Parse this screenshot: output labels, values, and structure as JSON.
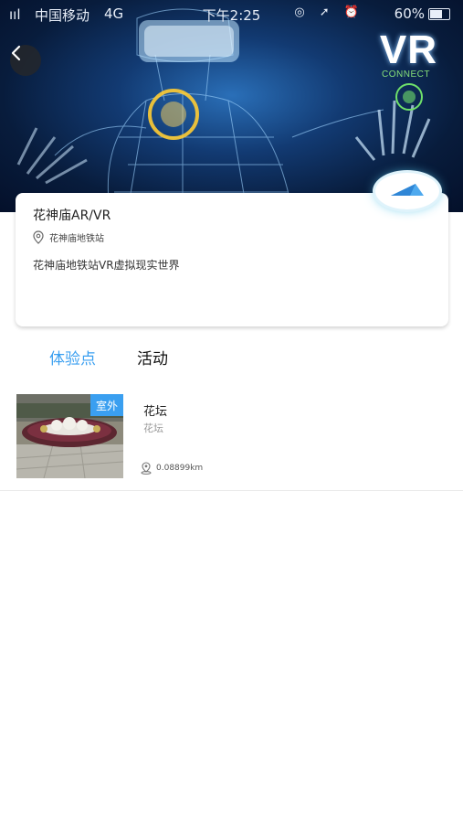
{
  "status_bar": {
    "signal": "ııl",
    "carrier": "中国移动",
    "network": "4G",
    "time": "下午2:25",
    "icons": "◎ ➚ ⏰",
    "battery": "60%"
  },
  "hero": {
    "logo_text": "VR",
    "logo_sub": "CONNECT"
  },
  "place": {
    "title": "花神庙AR/VR",
    "location": "花神庙地铁站",
    "description": "花神庙地铁站VR虚拟现实世界"
  },
  "tabs": [
    {
      "label": "体验点",
      "active": true
    },
    {
      "label": "活动",
      "active": false
    }
  ],
  "items": [
    {
      "name": "花坛",
      "subtitle": "花坛",
      "badge": "室外",
      "distance": "0.08899km"
    }
  ],
  "colors": {
    "accent": "#3a9ff0",
    "nav_glow": "#56c6ea"
  }
}
